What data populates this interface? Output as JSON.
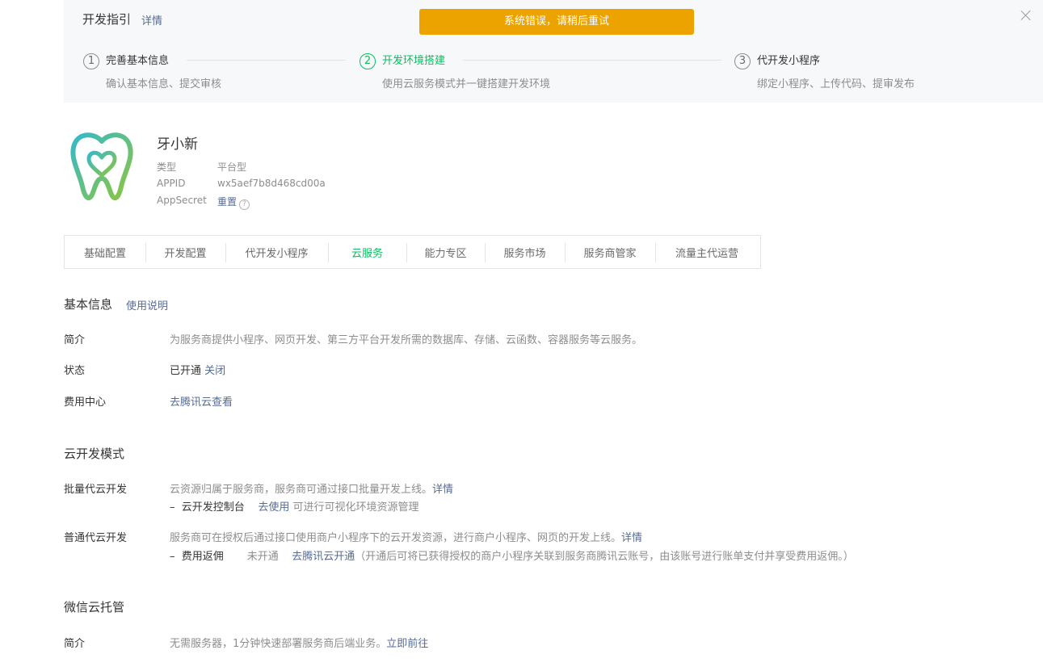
{
  "guide": {
    "title": "开发指引",
    "detail_link": "详情",
    "error_toast": "系统错误，请稍后重试",
    "steps": [
      {
        "num": "1",
        "label": "完善基本信息",
        "desc": "确认基本信息、提交审核"
      },
      {
        "num": "2",
        "label": "开发环境搭建",
        "desc": "使用云服务模式并一键搭建开发环境"
      },
      {
        "num": "3",
        "label": "代开发小程序",
        "desc": "绑定小程序、上传代码、提审发布"
      }
    ]
  },
  "app": {
    "name": "牙小新",
    "type_label": "类型",
    "type_value": "平台型",
    "appid_label": "APPID",
    "appid_value": "wx5aef7b8d468cd00a",
    "secret_label": "AppSecret",
    "secret_action": "重置",
    "help_glyph": "?",
    "logo_colors": {
      "teal": "#36b9c8",
      "green": "#8dc63f"
    }
  },
  "tabs": [
    {
      "label": "基础配置"
    },
    {
      "label": "开发配置"
    },
    {
      "label": "代开发小程序"
    },
    {
      "label": "云服务"
    },
    {
      "label": "能力专区"
    },
    {
      "label": "服务市场"
    },
    {
      "label": "服务商管家"
    },
    {
      "label": "流量主代运营"
    }
  ],
  "basic_info": {
    "title": "基本信息",
    "help_link": "使用说明",
    "intro_label": "简介",
    "intro_value": "为服务商提供小程序、网页开发、第三方平台开发所需的数据库、存储、云函数、容器服务等云服务。",
    "status_label": "状态",
    "status_value": "已开通",
    "status_action": "关闭",
    "fee_label": "费用中心",
    "fee_link": "去腾讯云查看"
  },
  "cloud_dev": {
    "title": "云开发模式",
    "batch_label": "批量代云开发",
    "batch_desc": "云资源归属于服务商，服务商可通过接口批量开发上线。",
    "batch_detail": "详情",
    "console_prefix": "–",
    "console_label": "云开发控制台",
    "console_link": "去使用",
    "console_desc": "可进行可视化环境资源管理",
    "normal_label": "普通代云开发",
    "normal_desc": "服务商可在授权后通过接口使用商户小程序下的云开发资源，进行商户小程序、网页的开发上线。",
    "normal_detail": "详情",
    "rebate_prefix": "–",
    "rebate_label": "费用返佣",
    "rebate_status": "未开通",
    "rebate_link": "去腾讯云开通",
    "rebate_desc": "（开通后可将已获得授权的商户小程序关联到服务商腾讯云账号，由该账号进行账单支付并享受费用返佣。）"
  },
  "wechat_cloud": {
    "title": "微信云托管",
    "intro_label": "简介",
    "intro_value": "无需服务器，1分钟快速部署服务商后端业务。",
    "intro_link": "立即前往"
  },
  "colors": {
    "accent_green": "#07c160",
    "link_blue": "#576b95",
    "warning": "#eca300",
    "banner_bg": "#f6f8f9"
  }
}
